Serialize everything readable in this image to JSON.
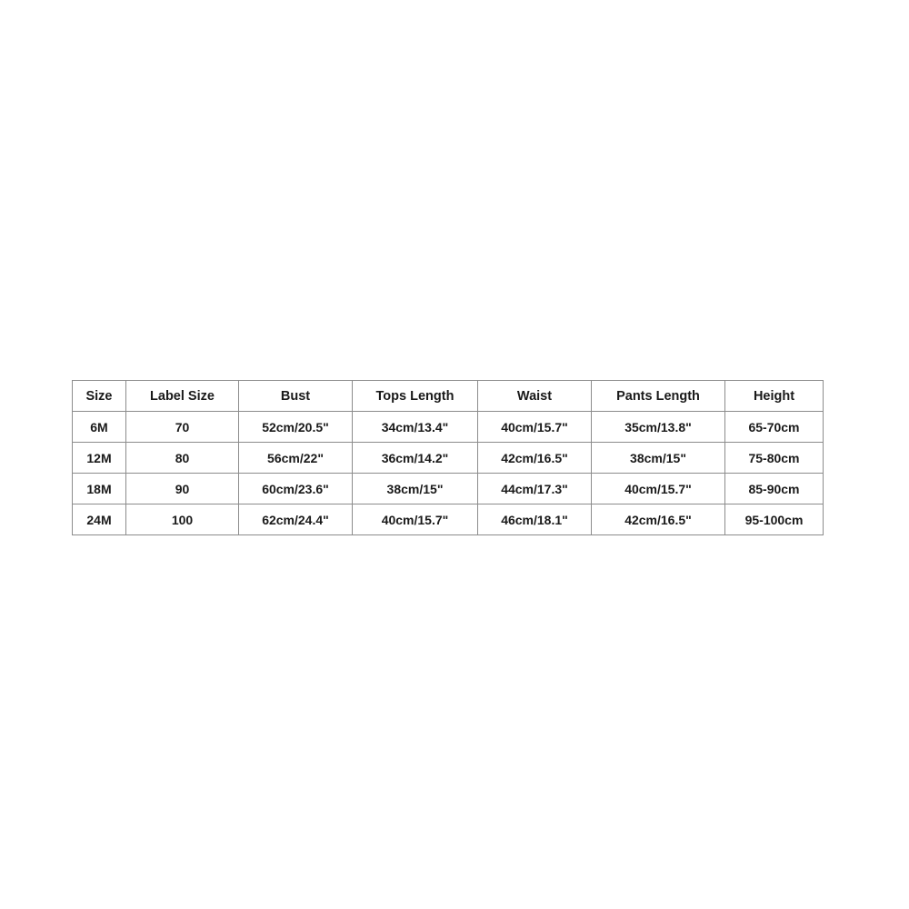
{
  "size_chart": {
    "headers": [
      "Size",
      "Label Size",
      "Bust",
      "Tops Length",
      "Waist",
      "Pants Length",
      "Height"
    ],
    "rows": [
      [
        "6M",
        "70",
        "52cm/20.5\"",
        "34cm/13.4\"",
        "40cm/15.7\"",
        "35cm/13.8\"",
        "65-70cm"
      ],
      [
        "12M",
        "80",
        "56cm/22\"",
        "36cm/14.2\"",
        "42cm/16.5\"",
        "38cm/15\"",
        "75-80cm"
      ],
      [
        "18M",
        "90",
        "60cm/23.6\"",
        "38cm/15\"",
        "44cm/17.3\"",
        "40cm/15.7\"",
        "85-90cm"
      ],
      [
        "24M",
        "100",
        "62cm/24.4\"",
        "40cm/15.7\"",
        "46cm/18.1\"",
        "42cm/16.5\"",
        "95-100cm"
      ]
    ]
  }
}
